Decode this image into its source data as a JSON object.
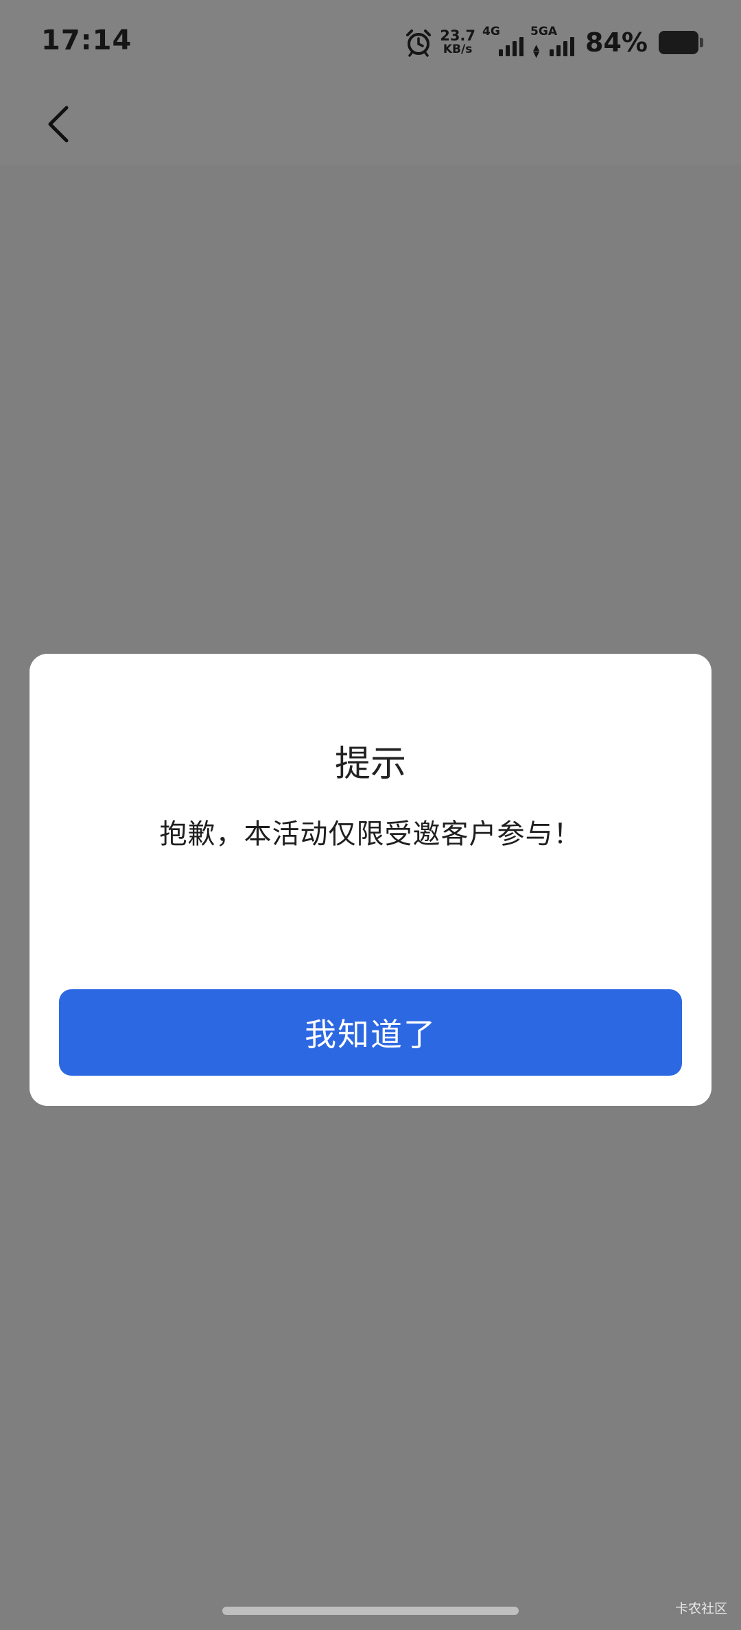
{
  "status_bar": {
    "time": "17:14",
    "alarm_icon": "alarm-clock-icon",
    "net_speed_value": "23.7",
    "net_speed_unit": "KB/s",
    "network_1": "4G",
    "network_2": "5GA",
    "battery_percent": "84%"
  },
  "nav": {
    "back_icon": "chevron-left-icon"
  },
  "dialog": {
    "title": "提示",
    "message": "抱歉，本活动仅限受邀客户参与！",
    "confirm_label": "我知道了",
    "confirm_color": "#2d68e3"
  },
  "watermark": "卡农社区",
  "colors": {
    "overlay": "#7f7f7f",
    "dialog_bg": "#ffffff"
  }
}
